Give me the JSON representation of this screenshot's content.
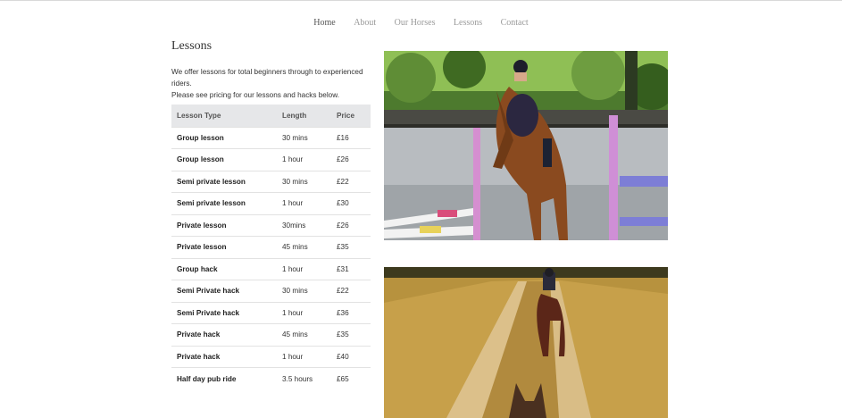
{
  "nav": {
    "items": [
      {
        "label": "Home",
        "active": true
      },
      {
        "label": "About",
        "active": false
      },
      {
        "label": "Our Horses",
        "active": false
      },
      {
        "label": "Lessons",
        "active": false
      },
      {
        "label": "Contact",
        "active": false
      }
    ]
  },
  "page": {
    "title": "Lessons",
    "intro_line1": "We offer lessons for total beginners through to experienced riders.",
    "intro_line2": "Please see pricing for our lessons and hacks below."
  },
  "table": {
    "headers": [
      "Lesson Type",
      "Length",
      "Price"
    ],
    "rows": [
      [
        "Group lesson",
        "30 mins",
        "£16"
      ],
      [
        "Group lesson",
        "1 hour",
        "£26"
      ],
      [
        "Semi private lesson",
        "30 mins",
        "£22"
      ],
      [
        "Semi private lesson",
        "1 hour",
        "£30"
      ],
      [
        "Private lesson",
        "30mins",
        "£26"
      ],
      [
        "Private lesson",
        "45 mins",
        "£35"
      ],
      [
        "Group hack",
        "1 hour",
        "£31"
      ],
      [
        "Semi Private hack",
        "30 mins",
        "£22"
      ],
      [
        "Semi Private hack",
        "1 hour",
        "£36"
      ],
      [
        "Private hack",
        "45 mins",
        "£35"
      ],
      [
        "Private hack",
        "1 hour",
        "£40"
      ],
      [
        "Half day pub ride",
        "3.5 hours",
        "£65"
      ]
    ]
  },
  "images": {
    "photo1": "rider-on-chestnut-horse-in-arena",
    "photo2": "horse-and-rider-on-field-path"
  }
}
